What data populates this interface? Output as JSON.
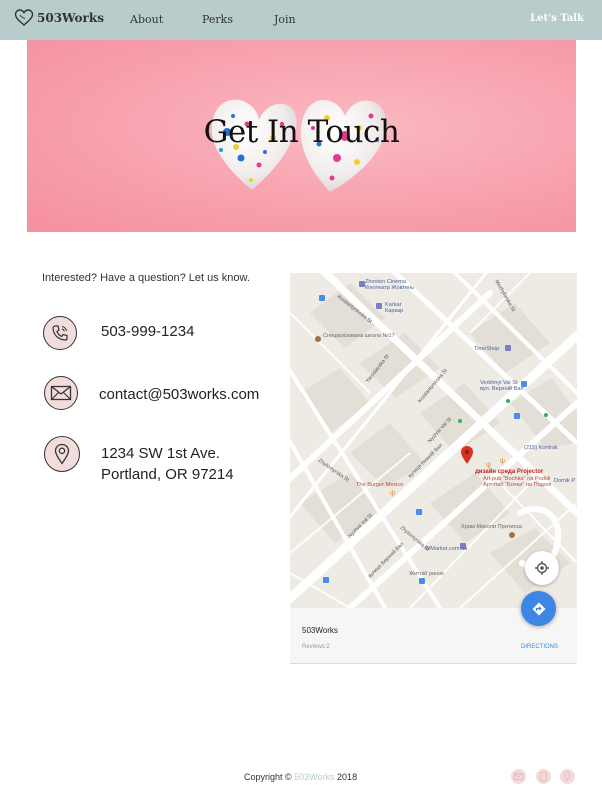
{
  "nav": {
    "brand": "503Works",
    "links": [
      "About",
      "Perks",
      "Join"
    ],
    "cta": "Let's Talk"
  },
  "hero": {
    "title": "Get In Touch"
  },
  "contact": {
    "intro": "Interested? Have a question? Let us know.",
    "phone": "503-999-1234",
    "email": "contact@503works.com",
    "address_line1": "1234 SW 1st Ave.",
    "address_line2": "Portland, OR 97214"
  },
  "map": {
    "place_name": "503Works",
    "reviews": "Reviews:2",
    "directions": "DIRECTIONS",
    "pin_label": "дизайн среда Projector",
    "labels": {
      "zhovten": "Zhovten Cinema",
      "zhovten_ua": "Кінотеатр Жовтень",
      "karkar": "Karkar",
      "karkar_ua": "Каркар",
      "school": "Спеціалізована школа №17",
      "timeshop": "TimeShop",
      "verkhnii": "Verkhnyi Val St",
      "verkhnii_ua": "вул. Верхній Вал",
      "burger": "The Burger Mexico",
      "artpub": "Art-pub \"Bochka\" na Podoli",
      "artpub_ua": "Арт-паб \"Бочка\" на Подолі",
      "church": "Храм Миколи Притиска",
      "wmarket": "WMarket.com.ua",
      "zhytnii": "Житній ринок",
      "kontrakt": "(215) Kontrak",
      "domik": "Domik P",
      "st_kostiantynivska": "Kostiantynivska St",
      "st_nyzhnii": "Nyzhnii Val St",
      "st_mezhyhirska": "Mezhyhirska St",
      "st_yaroslavska": "Yaroslavska St",
      "st_vulytsia": "вулиця Нижній Вал",
      "st_zhytomyrska": "Zhytomyrska St",
      "st_verkhnii_ua": "вулиця Верхній Вал"
    }
  },
  "footer": {
    "copyright_prefix": "Copyright ©",
    "brand": "503Works",
    "year": "2018"
  },
  "colors": {
    "nav_bg": "#b7cccb",
    "hero_pink": "#f8a5b2",
    "icon_bg": "#f3dcdc",
    "directions_blue": "#3d86e4"
  }
}
